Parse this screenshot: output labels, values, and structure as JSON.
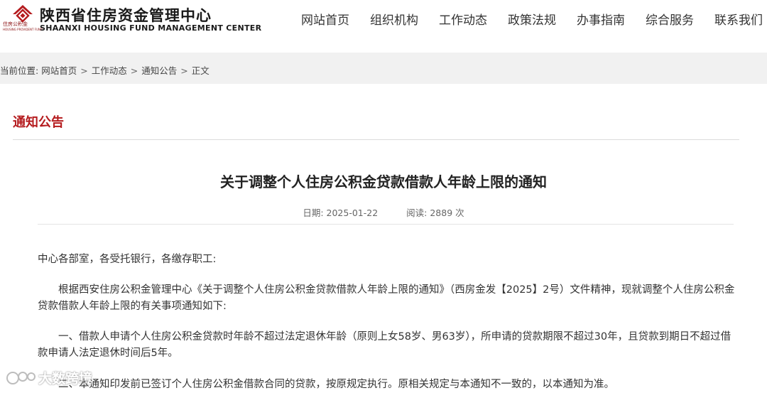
{
  "header": {
    "logo_small_cn": "住房公积金",
    "logo_small_en": "HOUSING PROVIDENT FUND",
    "logo_cn": "陕西省住房资金管理中心",
    "logo_en": "SHAANXI HOUSING FUND MANAGEMENT CENTER"
  },
  "nav": {
    "items": [
      {
        "label": "网站首页"
      },
      {
        "label": "组织机构"
      },
      {
        "label": "工作动态"
      },
      {
        "label": "政策法规"
      },
      {
        "label": "办事指南"
      },
      {
        "label": "综合服务"
      },
      {
        "label": "联系我们"
      }
    ]
  },
  "breadcrumb": {
    "prefix": "当前位置:",
    "items": [
      "网站首页",
      "工作动态",
      "通知公告",
      "正文"
    ],
    "separator": ">"
  },
  "section": {
    "title": "通知公告"
  },
  "article": {
    "title": "关于调整个人住房公积金贷款借款人年龄上限的通知",
    "date_label": "日期:",
    "date": "2025-01-22",
    "views_label": "阅读:",
    "views": "2889",
    "views_unit": "次",
    "paragraphs": [
      "中心各部室，各受托银行，各缴存职工:",
      "根据西安住房公积金管理中心《关于调整个人住房公积金贷款借款人年龄上限的通知》（西房金发【2025】2号）文件精神，现就调整个人住房公积金贷款借款人年龄上限的有关事项通知如下:",
      "一、借款人申请个人住房公积金贷款时年龄不超过法定退休年龄（原则上女58岁、男63岁），所申请的贷款期限不超过30年，且贷款到期日不超过借款申请人法定退休时间后5年。",
      "二、本通知印发前已签订个人住房公积金借款合同的贷款，按原规定执行。原相关规定与本通知不一致的，以本通知为准。"
    ]
  },
  "watermark": {
    "text": "大数跨境"
  },
  "colors": {
    "accent_red": "#b51c1f",
    "breadcrumb_bg": "#f1f1f1"
  }
}
